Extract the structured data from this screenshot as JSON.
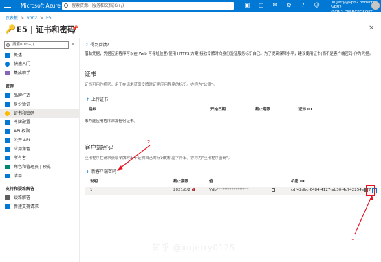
{
  "topbar": {
    "brand": "Microsoft Azure",
    "search_placeholder": "搜索资源、服务和文档(G+/)",
    "account_line1": "XuJerry@vpn2.onmicros...",
    "account_line2": "VPN2 (VPN2.ONMICROSOFT..."
  },
  "breadcrumb": [
    "仪表板",
    "vpn2",
    "E5"
  ],
  "page": {
    "title": "E5 | 证书和密码"
  },
  "sidebar": {
    "search_placeholder": "搜索(Ctrl+/)",
    "items_top": [
      {
        "label": "概述",
        "icon": "overview-icon"
      },
      {
        "label": "快速入门",
        "icon": "quickstart-icon"
      },
      {
        "label": "集成助手",
        "icon": "integration-assistant-icon"
      }
    ],
    "manage_section": "管理",
    "items_manage": [
      {
        "label": "品牌打造",
        "icon": "branding-icon"
      },
      {
        "label": "身份验证",
        "icon": "authentication-icon"
      },
      {
        "label": "证书和密码",
        "icon": "key-icon",
        "active": true
      },
      {
        "label": "令牌配置",
        "icon": "token-config-icon"
      },
      {
        "label": "API 权限",
        "icon": "api-permissions-icon"
      },
      {
        "label": "公开 API",
        "icon": "expose-api-icon"
      },
      {
        "label": "应用角色",
        "icon": "app-roles-icon"
      },
      {
        "label": "所有者",
        "icon": "owners-icon"
      },
      {
        "label": "角色和管理员 | 预览",
        "icon": "roles-admins-icon"
      },
      {
        "label": "清单",
        "icon": "manifest-icon"
      }
    ],
    "support_section": "支持和疑难解答",
    "items_support": [
      {
        "label": "疑难解答",
        "icon": "troubleshoot-icon"
      },
      {
        "label": "新建支持请求",
        "icon": "support-request-icon"
      }
    ]
  },
  "main": {
    "feedback": "得到反馈?",
    "description": "借助凭据，凭据应用程序可以在 Web 可寻址位置(使用 HTTPS 方案)接收令牌时向身份验证服务标识自己。为了提高保障水平，建议使用证书(而不是客户端密码)作为凭据。",
    "cert": {
      "header": "证书",
      "subtitle": "证书可用作机密，用于在请求获取令牌时证明应用程序的标识。亦称为\"公钥\"。",
      "upload": "上传证书",
      "columns": [
        "指纹",
        "开始日期",
        "截止期限",
        "证书 ID"
      ],
      "empty": "未为此应用程序添加任何证书。"
    },
    "secret": {
      "header": "客户端密码",
      "subtitle": "应用程序在请求获取令牌时用于证明自己的标识的机密字符串。亦称为\"应用程序密码\"。",
      "add": "新客户端密码",
      "columns": [
        "说明",
        "截止期限",
        "值",
        "机密 ID"
      ],
      "rows": [
        {
          "description": "1",
          "expires": "2021/8/2",
          "value": "Vdb*****************",
          "secret_id": "cdf42dbc-6484-4127-ab30-4c742254ea77"
        }
      ]
    }
  },
  "annotations": {
    "label_1": "1",
    "label_2": "2",
    "color": "#e81123"
  },
  "watermark": "知乎 @xujerry0125"
}
